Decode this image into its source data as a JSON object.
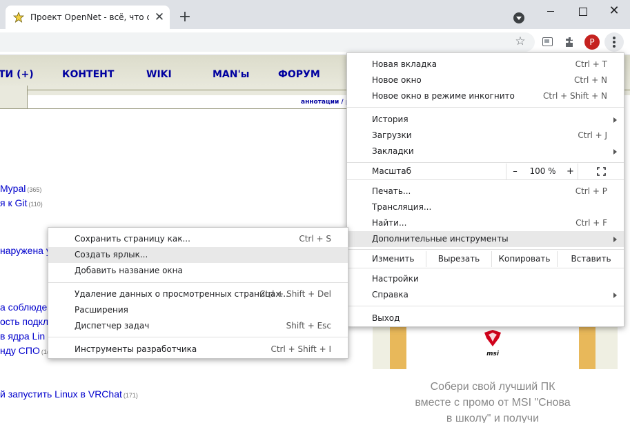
{
  "browser": {
    "tab_title": "Проект OpenNet - всё, что связано",
    "tab_close": "✕",
    "new_tab": "+",
    "profile_initial": "P",
    "window_close": "✕",
    "icons": [
      "star-favicon",
      "close-icon",
      "plus-icon",
      "tab-search-icon",
      "minimize-icon",
      "maximize-icon",
      "window-close-icon",
      "bookmark-star-icon",
      "cast-icon",
      "puzzle-icon",
      "avatar",
      "kebab-menu-icon"
    ]
  },
  "site": {
    "nav": [
      "ТИ (+)",
      "КОНТЕНТ",
      "WIKI",
      "MAN'ы",
      "ФОРУМ"
    ],
    "annotation_link": "аннотации / р",
    "news": [
      {
        "text": "Mypal",
        "count": "(365)"
      },
      {
        "text": "я к Git",
        "count": "(110)"
      },
      {
        "text": "наружена у",
        "count": ""
      },
      {
        "text": "а соблюде",
        "count": ""
      },
      {
        "text": "ость подкл",
        "count": ""
      },
      {
        "text": "в ядра Lin",
        "count": ""
      },
      {
        "text": "нду СПО",
        "count": "(1("
      },
      {
        "text": "й запустить Linux в VRChat",
        "count": "(171)"
      }
    ],
    "ad": {
      "logo_text": "msi",
      "text": "Собери свой лучший ПК вместе с промо от MSI \"Снова в школу\" и получи"
    }
  },
  "main_menu": {
    "new_tab": {
      "label": "Новая вкладка",
      "shortcut": "Ctrl + T"
    },
    "new_window": {
      "label": "Новое окно",
      "shortcut": "Ctrl + N"
    },
    "incognito": {
      "label": "Новое окно в режиме инкогнито",
      "shortcut": "Ctrl + Shift + N"
    },
    "history": {
      "label": "История"
    },
    "downloads": {
      "label": "Загрузки",
      "shortcut": "Ctrl + J"
    },
    "bookmarks": {
      "label": "Закладки"
    },
    "zoom": {
      "label": "Масштаб",
      "minus": "–",
      "value": "100 %",
      "plus": "+"
    },
    "print": {
      "label": "Печать...",
      "shortcut": "Ctrl + P"
    },
    "cast": {
      "label": "Трансляция..."
    },
    "find": {
      "label": "Найти...",
      "shortcut": "Ctrl + F"
    },
    "more_tools": {
      "label": "Дополнительные инструменты"
    },
    "edit": {
      "label": "Изменить",
      "cut": "Вырезать",
      "copy": "Копировать",
      "paste": "Вставить"
    },
    "settings": {
      "label": "Настройки"
    },
    "help": {
      "label": "Справка"
    },
    "exit": {
      "label": "Выход"
    }
  },
  "sub_menu": {
    "save_page": {
      "label": "Сохранить страницу как...",
      "shortcut": "Ctrl + S"
    },
    "create_shortcut": {
      "label": "Создать ярлык..."
    },
    "name_window": {
      "label": "Добавить название окна"
    },
    "clear_data": {
      "label": "Удаление данных о просмотренных страницах...",
      "shortcut": "Ctrl + Shift + Del"
    },
    "extensions": {
      "label": "Расширения"
    },
    "task_manager": {
      "label": "Диспетчер задач",
      "shortcut": "Shift + Esc"
    },
    "dev_tools": {
      "label": "Инструменты разработчика",
      "shortcut": "Ctrl + Shift + I"
    }
  },
  "colors": {
    "nav_link": "#0000a0",
    "news_link": "#0000cc",
    "avatar": "#c5221f",
    "ad_frame": "#e8b85a",
    "msi_red": "#d0021b"
  }
}
